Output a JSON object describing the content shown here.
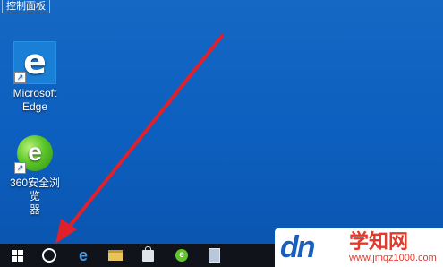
{
  "desktop": {
    "control_panel_label": "控制面板",
    "icons": [
      {
        "label_line1": "Microsoft",
        "label_line2": "Edge",
        "icon": "edge-icon"
      },
      {
        "label_line1": "360安全浏览",
        "label_line2": "器",
        "icon": "360-browser-icon"
      }
    ]
  },
  "taskbar": {
    "items": [
      "start-windows-icon",
      "cortana-search-icon",
      "edge-icon",
      "file-explorer-icon",
      "store-icon",
      "360-browser-icon",
      "notepad-icon"
    ]
  },
  "annotation": {
    "arrow_color": "#e0202a"
  },
  "watermark": {
    "logo": "dn",
    "site_name": "学知网",
    "url": "www.jmqz1000.com"
  },
  "colors": {
    "desktop": "#0d5fbf",
    "taskbar": "#10131a",
    "accent": "#1a7fd6"
  }
}
